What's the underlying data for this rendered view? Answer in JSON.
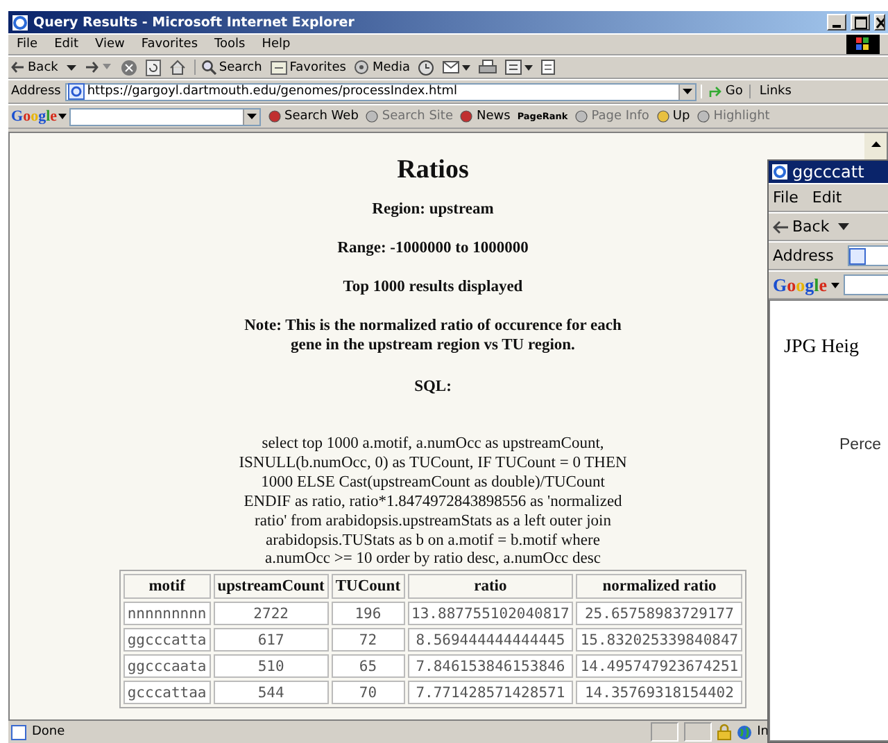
{
  "window": {
    "title": "Query Results - Microsoft Internet Explorer"
  },
  "menu": [
    "File",
    "Edit",
    "View",
    "Favorites",
    "Tools",
    "Help"
  ],
  "toolbar": [
    {
      "kind": "back",
      "label": "Back"
    },
    {
      "kind": "forward"
    },
    {
      "kind": "stop"
    },
    {
      "kind": "refresh"
    },
    {
      "kind": "home"
    },
    {
      "kind": "search",
      "label": "Search"
    },
    {
      "kind": "favorites",
      "label": "Favorites"
    },
    {
      "kind": "media",
      "label": "Media"
    },
    {
      "kind": "history"
    },
    {
      "kind": "mail"
    },
    {
      "kind": "print"
    },
    {
      "kind": "edit"
    },
    {
      "kind": "discuss"
    }
  ],
  "address": {
    "label": "Address",
    "url": "https://gargoyl.dartmouth.edu/genomes/processIndex.html",
    "go": "Go",
    "links": "Links"
  },
  "google_bar": {
    "logo": "Google",
    "items": [
      {
        "label": "Search Web",
        "disabled": false
      },
      {
        "label": "Search Site",
        "disabled": true
      },
      {
        "label": "News",
        "disabled": false
      },
      {
        "label": "PageRank",
        "disabled": false
      },
      {
        "label": "Page Info",
        "disabled": true
      },
      {
        "label": "Up",
        "disabled": false
      },
      {
        "label": "Highlight",
        "disabled": true
      }
    ]
  },
  "page": {
    "title": "Ratios",
    "lines": [
      "Region: upstream",
      "Range: -1000000 to 1000000",
      "Top 1000 results displayed",
      "Note: This is the normalized ratio of occurence for each gene in the upstream region vs TU region."
    ],
    "sql_label": "SQL:",
    "sql": "select top 1000 a.motif, a.numOcc as upstreamCount, ISNULL(b.numOcc, 0) as TUCount, IF TUCount = 0 THEN 1000 ELSE Cast(upstreamCount as double)/TUCount ENDIF as ratio, ratio*1.8474972843898556 as 'normalized ratio' from arabidopsis.upstreamStats as a left outer join arabidopsis.TUStats as b on a.motif = b.motif where a.numOcc >= 10 order by ratio desc, a.numOcc desc",
    "table": {
      "columns": [
        "motif",
        "upstreamCount",
        "TUCount",
        "ratio",
        "normalized ratio"
      ],
      "rows": [
        [
          "nnnnnnnnn",
          "2722",
          "196",
          "13.887755102040817",
          "25.65758983729177"
        ],
        [
          "ggcccatta",
          "617",
          "72",
          "8.569444444444445",
          "15.832025339840847"
        ],
        [
          "ggcccaata",
          "510",
          "65",
          "7.846153846153846",
          "14.495747923674251"
        ],
        [
          "gcccattaa",
          "544",
          "70",
          "7.771428571428571",
          "14.35769318154402"
        ]
      ]
    }
  },
  "status_bar": {
    "text": "Done",
    "zone": "In"
  },
  "second_window": {
    "title": "ggcccatt",
    "menu": [
      "File",
      "Edit"
    ],
    "back": "Back",
    "address_label": "Address",
    "google": "Google",
    "heading": "JPG Heig",
    "text": "Perce"
  }
}
